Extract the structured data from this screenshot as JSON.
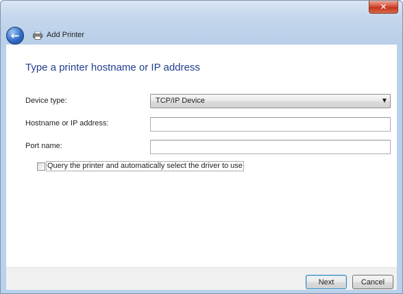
{
  "window": {
    "title": "Add Printer",
    "close_glyph": "✕"
  },
  "icons": {
    "back": "back-arrow-icon",
    "printer": "printer-icon",
    "close": "close-icon",
    "dropdown": "chevron-down-icon"
  },
  "main": {
    "heading": "Type a printer hostname or IP address",
    "device_type": {
      "label": "Device type:",
      "selected": "TCP/IP Device"
    },
    "hostname": {
      "label": "Hostname or IP address:",
      "value": ""
    },
    "port": {
      "label": "Port name:",
      "value": ""
    },
    "query_checkbox": {
      "label": "Query the printer and automatically select the driver to use",
      "checked": false
    }
  },
  "footer": {
    "next_label": "Next",
    "cancel_label": "Cancel"
  },
  "colors": {
    "heading": "#1f3d8c",
    "frame": "#b9d1ea",
    "close_button": "#c2351b"
  }
}
